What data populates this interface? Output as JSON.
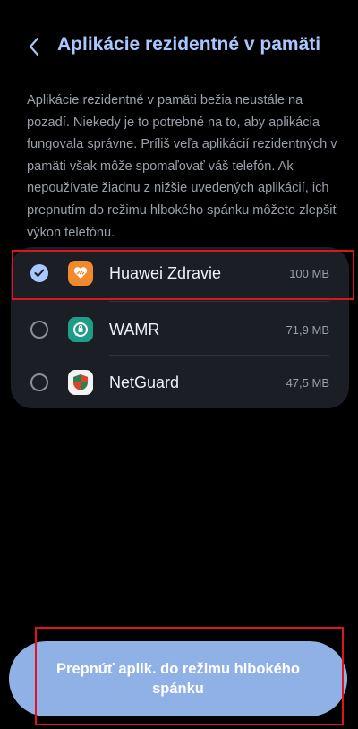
{
  "header": {
    "title": "Aplikácie rezidentné v pamäti"
  },
  "description": "Aplikácie rezidentné v pamäti bežia neustále na pozadí. Niekedy je to potrebné na to, aby aplikácia fungovala správne. Príliš veľa aplikácií rezidentných v pamäti však môže spomaľovať váš telefón. Ak nepoužívate žiadnu z nižšie uvedených aplikácií, ich prepnutím do režimu hlbokého spánku môžete zlepšiť výkon telefónu.",
  "apps": [
    {
      "name": "Huawei Zdravie",
      "size": "100 MB",
      "checked": true,
      "icon": "huawei-health-icon"
    },
    {
      "name": "WAMR",
      "size": "71,9 MB",
      "checked": false,
      "icon": "wamr-icon"
    },
    {
      "name": "NetGuard",
      "size": "47,5 MB",
      "checked": false,
      "icon": "netguard-icon"
    }
  ],
  "action_button": {
    "label": "Prepnúť aplik. do režimu hlbokého spánku"
  },
  "colors": {
    "accent": "#a9c7ff",
    "button": "#8fb1e6",
    "card": "#1b1e24",
    "highlight": "#e0141e"
  }
}
